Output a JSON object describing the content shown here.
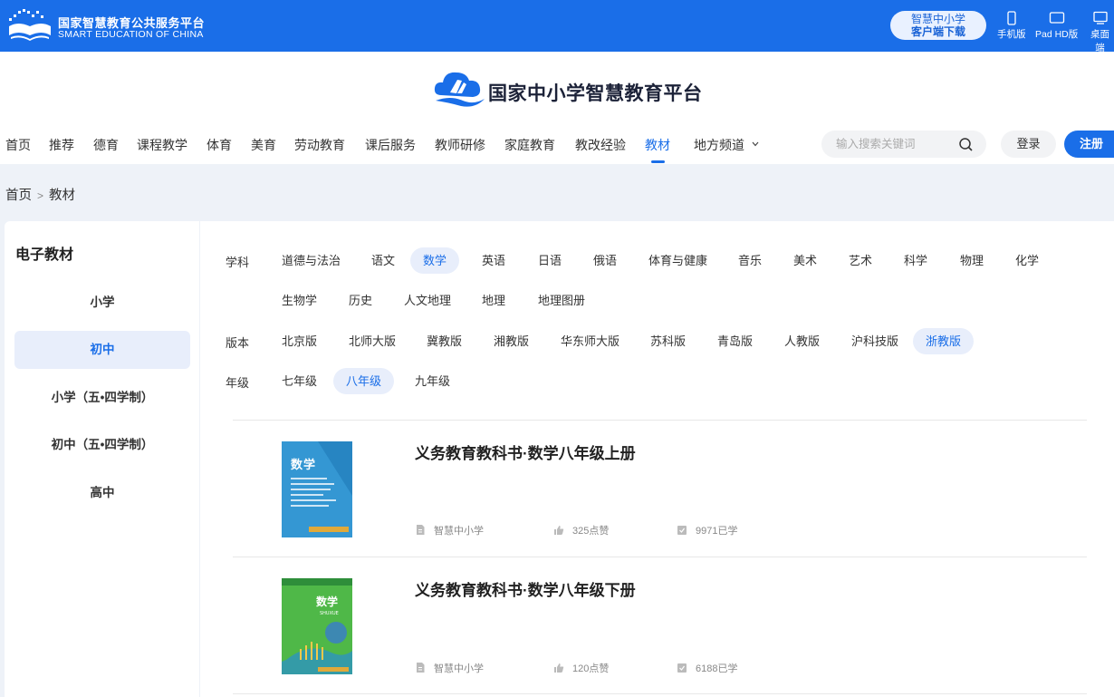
{
  "topbar": {
    "brand_cn": "国家智慧教育公共服务平台",
    "brand_en": "SMART EDUCATION OF CHINA",
    "download_line1": "智慧中小学",
    "download_line2": "客户端下载",
    "devices": [
      "手机版",
      "Pad HD版",
      "桌面端"
    ]
  },
  "header": {
    "site_title": "国家中小学智慧教育平台",
    "nav": [
      "首页",
      "推荐",
      "德育",
      "课程教学",
      "体育",
      "美育",
      "劳动教育",
      "课后服务",
      "教师研修",
      "家庭教育",
      "教改经验",
      "教材",
      "地方频道"
    ],
    "active_nav": "教材",
    "search_placeholder": "输入搜索关键词",
    "login": "登录",
    "register": "注册"
  },
  "breadcrumb": {
    "home": "首页",
    "sep": ">",
    "current": "教材"
  },
  "sidebar": {
    "title": "电子教材",
    "items": [
      "小学",
      "初中",
      "小学（五•四学制）",
      "初中（五•四学制）",
      "高中"
    ],
    "active": "初中"
  },
  "filters": {
    "subject_label": "学科",
    "subjects": [
      "道德与法治",
      "语文",
      "数学",
      "英语",
      "日语",
      "俄语",
      "体育与健康",
      "音乐",
      "美术",
      "艺术",
      "科学",
      "物理",
      "化学",
      "生物学",
      "历史",
      "人文地理",
      "地理",
      "地理图册"
    ],
    "subject_active": "数学",
    "edition_label": "版本",
    "editions": [
      "北京版",
      "北师大版",
      "冀教版",
      "湘教版",
      "华东师大版",
      "苏科版",
      "青岛版",
      "人教版",
      "沪科技版",
      "浙教版"
    ],
    "edition_active": "浙教版",
    "grade_label": "年级",
    "grades": [
      "七年级",
      "八年级",
      "九年级"
    ],
    "grade_active": "八年级"
  },
  "books": [
    {
      "title": "义务教育教科书·数学八年级上册",
      "source": "智慧中小学",
      "likes": "325点赞",
      "learners": "9971已学",
      "cover_color": "#2f8fcf"
    },
    {
      "title": "义务教育教科书·数学八年级下册",
      "source": "智慧中小学",
      "likes": "120点赞",
      "learners": "6188已学",
      "cover_color": "#4fb848"
    }
  ],
  "colors": {
    "primary": "#1a6ee8",
    "active_bg": "#e8eefb"
  }
}
